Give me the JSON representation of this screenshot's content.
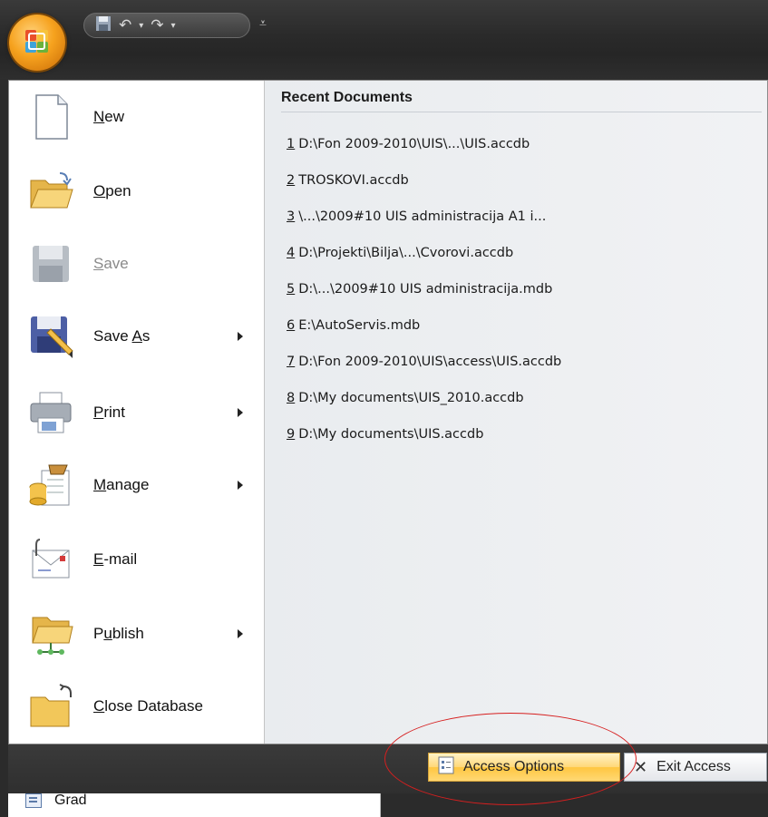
{
  "quick_access": {
    "save_icon": "floppy-disk-icon",
    "undo_icon": "undo-icon",
    "redo_icon": "redo-icon"
  },
  "left_menu": [
    {
      "label": "New",
      "mnemonic": "N",
      "icon": "new-document-icon",
      "submenu": false,
      "enabled": true
    },
    {
      "label": "Open",
      "mnemonic": "O",
      "icon": "open-folder-icon",
      "submenu": false,
      "enabled": true
    },
    {
      "label": "Save",
      "mnemonic": "S",
      "icon": "save-icon",
      "submenu": false,
      "enabled": false
    },
    {
      "label": "Save As",
      "mnemonic": "A",
      "icon": "save-as-icon",
      "submenu": true,
      "enabled": true
    },
    {
      "label": "Print",
      "mnemonic": "P",
      "icon": "print-icon",
      "submenu": true,
      "enabled": true
    },
    {
      "label": "Manage",
      "mnemonic": "M",
      "icon": "manage-icon",
      "submenu": true,
      "enabled": true
    },
    {
      "label": "E-mail",
      "mnemonic": "E",
      "icon": "email-icon",
      "submenu": false,
      "enabled": true
    },
    {
      "label": "Publish",
      "mnemonic": "u",
      "icon": "publish-icon",
      "submenu": true,
      "enabled": true
    },
    {
      "label": "Close Database",
      "mnemonic": "C",
      "icon": "close-database-icon",
      "submenu": false,
      "enabled": true
    }
  ],
  "recent": {
    "title": "Recent Documents",
    "items": [
      {
        "num": "1",
        "path": "D:\\Fon 2009-2010\\UIS\\...\\UIS.accdb"
      },
      {
        "num": "2",
        "path": "TROSKOVI.accdb"
      },
      {
        "num": "3",
        "path": "\\...\\2009#10 UIS administracija A1 i..."
      },
      {
        "num": "4",
        "path": "D:\\Projekti\\Bilja\\...\\Cvorovi.accdb"
      },
      {
        "num": "5",
        "path": "D:\\...\\2009#10 UIS administracija.mdb"
      },
      {
        "num": "6",
        "path": "E:\\AutoServis.mdb"
      },
      {
        "num": "7",
        "path": "D:\\Fon 2009-2010\\UIS\\access\\UIS.accdb"
      },
      {
        "num": "8",
        "path": "D:\\My documents\\UIS_2010.accdb"
      },
      {
        "num": "9",
        "path": "D:\\My documents\\UIS.accdb"
      }
    ]
  },
  "footer": {
    "options_label": "Access Options",
    "exit_label": "Exit Access"
  },
  "nav": {
    "item_label": "Grad"
  },
  "colors": {
    "accent": "#ffd778",
    "highlight": "#d61f1f",
    "chrome_dark": "#2b2b2b"
  }
}
